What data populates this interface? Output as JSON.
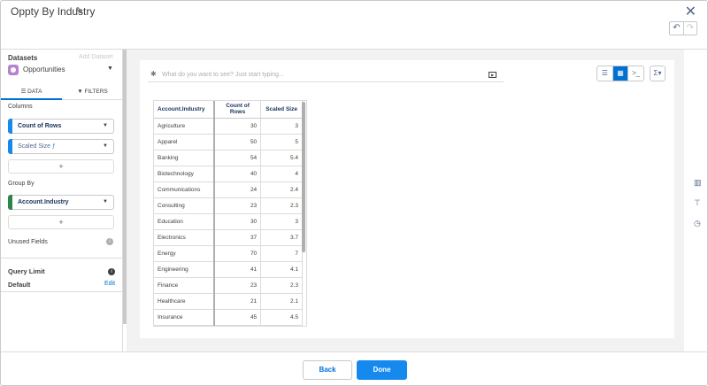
{
  "header": {
    "title": "Oppty By Industry",
    "edit_icon": "pencil-icon",
    "close_icon": "close-icon",
    "undo_icon": "undo-icon",
    "redo_icon": "redo-icon"
  },
  "sidebar": {
    "datasets_label": "Datasets",
    "add_dataset_label": "Add Dataset",
    "dataset_name": "Opportunities",
    "dataset_icon_color": "#b781d3",
    "tabs": [
      {
        "label": "DATA",
        "icon": "list-icon",
        "active": true
      },
      {
        "label": "FILTERS",
        "icon": "filter-icon",
        "active": false
      }
    ],
    "columns_label": "Columns",
    "columns": [
      {
        "label": "Count of Rows",
        "bar_color": "#1589ee"
      },
      {
        "label": "Scaled Size",
        "bar_color": "#1589ee"
      }
    ],
    "add_label": "+",
    "group_by_label": "Group By",
    "group_by": [
      {
        "label": "Account.Industry",
        "bar_color": "#2e844a"
      }
    ],
    "unused_fields_label": "Unused Fields",
    "query_limit_label": "Query Limit",
    "default_label": "Default",
    "edit_label": "Edit"
  },
  "main": {
    "search_placeholder": "What do you want to see? Just start typing...",
    "viz_buttons": [
      "chart-lines-icon",
      "table-icon",
      "code-icon"
    ],
    "active_viz": "table-icon",
    "sigma_label": "Σ▾",
    "accent_color": "#0070d2"
  },
  "table": {
    "headers": [
      "Account.Industry",
      "Count of Rows",
      "Scaled Size"
    ],
    "rows": [
      [
        "Agriculture",
        "30",
        "3"
      ],
      [
        "Apparel",
        "50",
        "5"
      ],
      [
        "Banking",
        "54",
        "5.4"
      ],
      [
        "Biotechnology",
        "40",
        "4"
      ],
      [
        "Communications",
        "24",
        "2.4"
      ],
      [
        "Consulting",
        "23",
        "2.3"
      ],
      [
        "Education",
        "30",
        "3"
      ],
      [
        "Electronics",
        "37",
        "3.7"
      ],
      [
        "Energy",
        "70",
        "7"
      ],
      [
        "Engineering",
        "41",
        "4.1"
      ],
      [
        "Finance",
        "23",
        "2.3"
      ],
      [
        "Healthcare",
        "21",
        "2.1"
      ],
      [
        "Insurance",
        "45",
        "4.5"
      ],
      [
        "",
        "",
        ""
      ]
    ]
  },
  "right_rail": [
    "bar-chart-icon",
    "paint-roller-icon",
    "clock-icon"
  ],
  "footer": {
    "back_label": "Back",
    "done_label": "Done"
  }
}
